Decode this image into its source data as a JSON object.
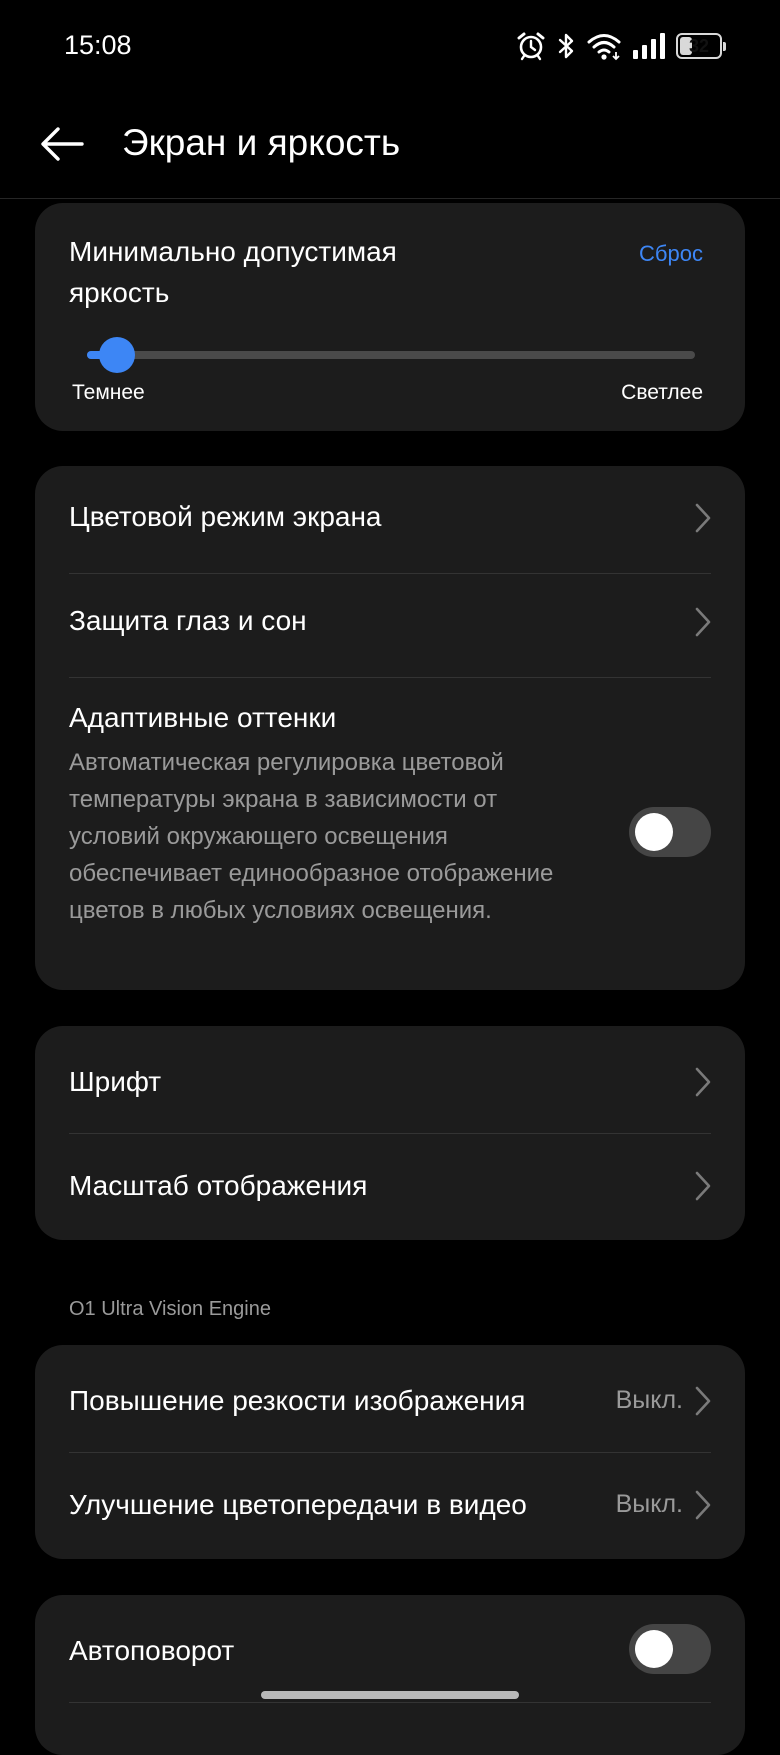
{
  "status_bar": {
    "time": "15:08",
    "battery": "32",
    "battery_level": 0.32,
    "icons": [
      "alarm-icon",
      "bluetooth-icon",
      "wifi-icon",
      "signal-icon",
      "battery-icon"
    ]
  },
  "header": {
    "title": "Экран и яркость",
    "back_icon": "back-arrow-icon"
  },
  "brightness": {
    "title": "Минимально допустимая яркость",
    "reset_label": "Сброс",
    "slider_value": 0.05,
    "min_label": "Темнее",
    "max_label": "Светлее"
  },
  "display_group": {
    "color_mode_label": "Цветовой режим экрана",
    "eye_protection_label": "Защита глаз и сон",
    "adaptive_title": "Адаптивные оттенки",
    "adaptive_description": "Автоматическая регулировка цветовой температуры экрана в зависимости от условий окружающего освещения обеспечивает единообразное отображение цветов в любых условиях освещения.",
    "adaptive_enabled": false
  },
  "font_group": {
    "font_label": "Шрифт",
    "display_scale_label": "Масштаб отображения"
  },
  "vision_section": {
    "header": "O1 Ultra Vision Engine",
    "sharpness_label": "Повышение резкости изображения",
    "sharpness_value": "Выкл.",
    "video_color_label": "Улучшение цветопередачи в видео",
    "video_color_value": "Выкл."
  },
  "rotate_group": {
    "autorotate_label": "Автоповорот",
    "autorotate_enabled": false
  },
  "colors": {
    "accent": "#3d86f5",
    "background": "#000000",
    "card": "#1c1c1c",
    "secondary_text": "#9a9a9a"
  }
}
